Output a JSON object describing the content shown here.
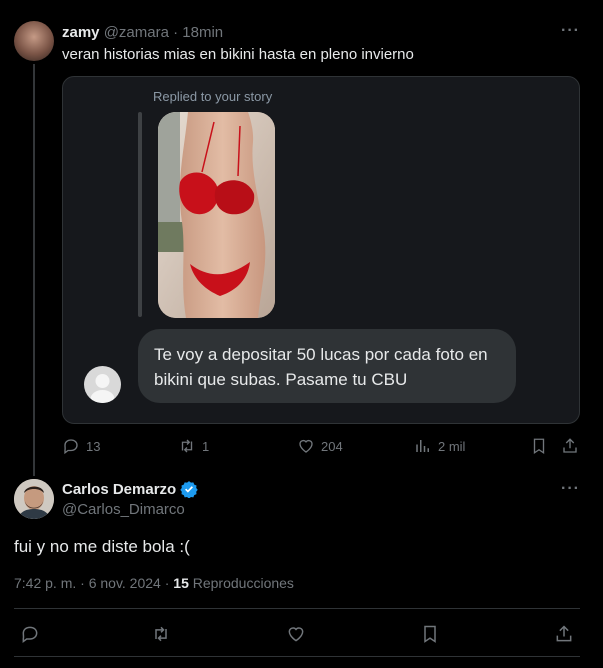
{
  "original_tweet": {
    "display_name": "zamy",
    "handle": "@zamara",
    "time": "· 18min",
    "text": "veran historias mias en bikini hasta en pleno invierno",
    "more_icon": "···"
  },
  "story_card": {
    "replied_label": "Replied to your story",
    "message": "Te voy a depositar 50 lucas por cada foto en bikini que subas. Pasame tu CBU"
  },
  "original_actions": {
    "replies": "13",
    "reposts": "1",
    "likes": "204",
    "views": "2 mil"
  },
  "reply_tweet": {
    "display_name": "Carlos Demarzo",
    "handle": "@Carlos_Dimarco",
    "text": "fui y no me diste bola :(",
    "timestamp": "7:42 p. m. · 6 nov. 2024 ·",
    "views_count": "15",
    "views_label": "Reproducciones",
    "more_icon": "···",
    "verified_color": "#1d9bf0"
  },
  "icons": [
    "reply-icon",
    "repost-icon",
    "like-icon",
    "views-icon",
    "bookmark-icon",
    "share-icon",
    "verified-badge-icon"
  ]
}
